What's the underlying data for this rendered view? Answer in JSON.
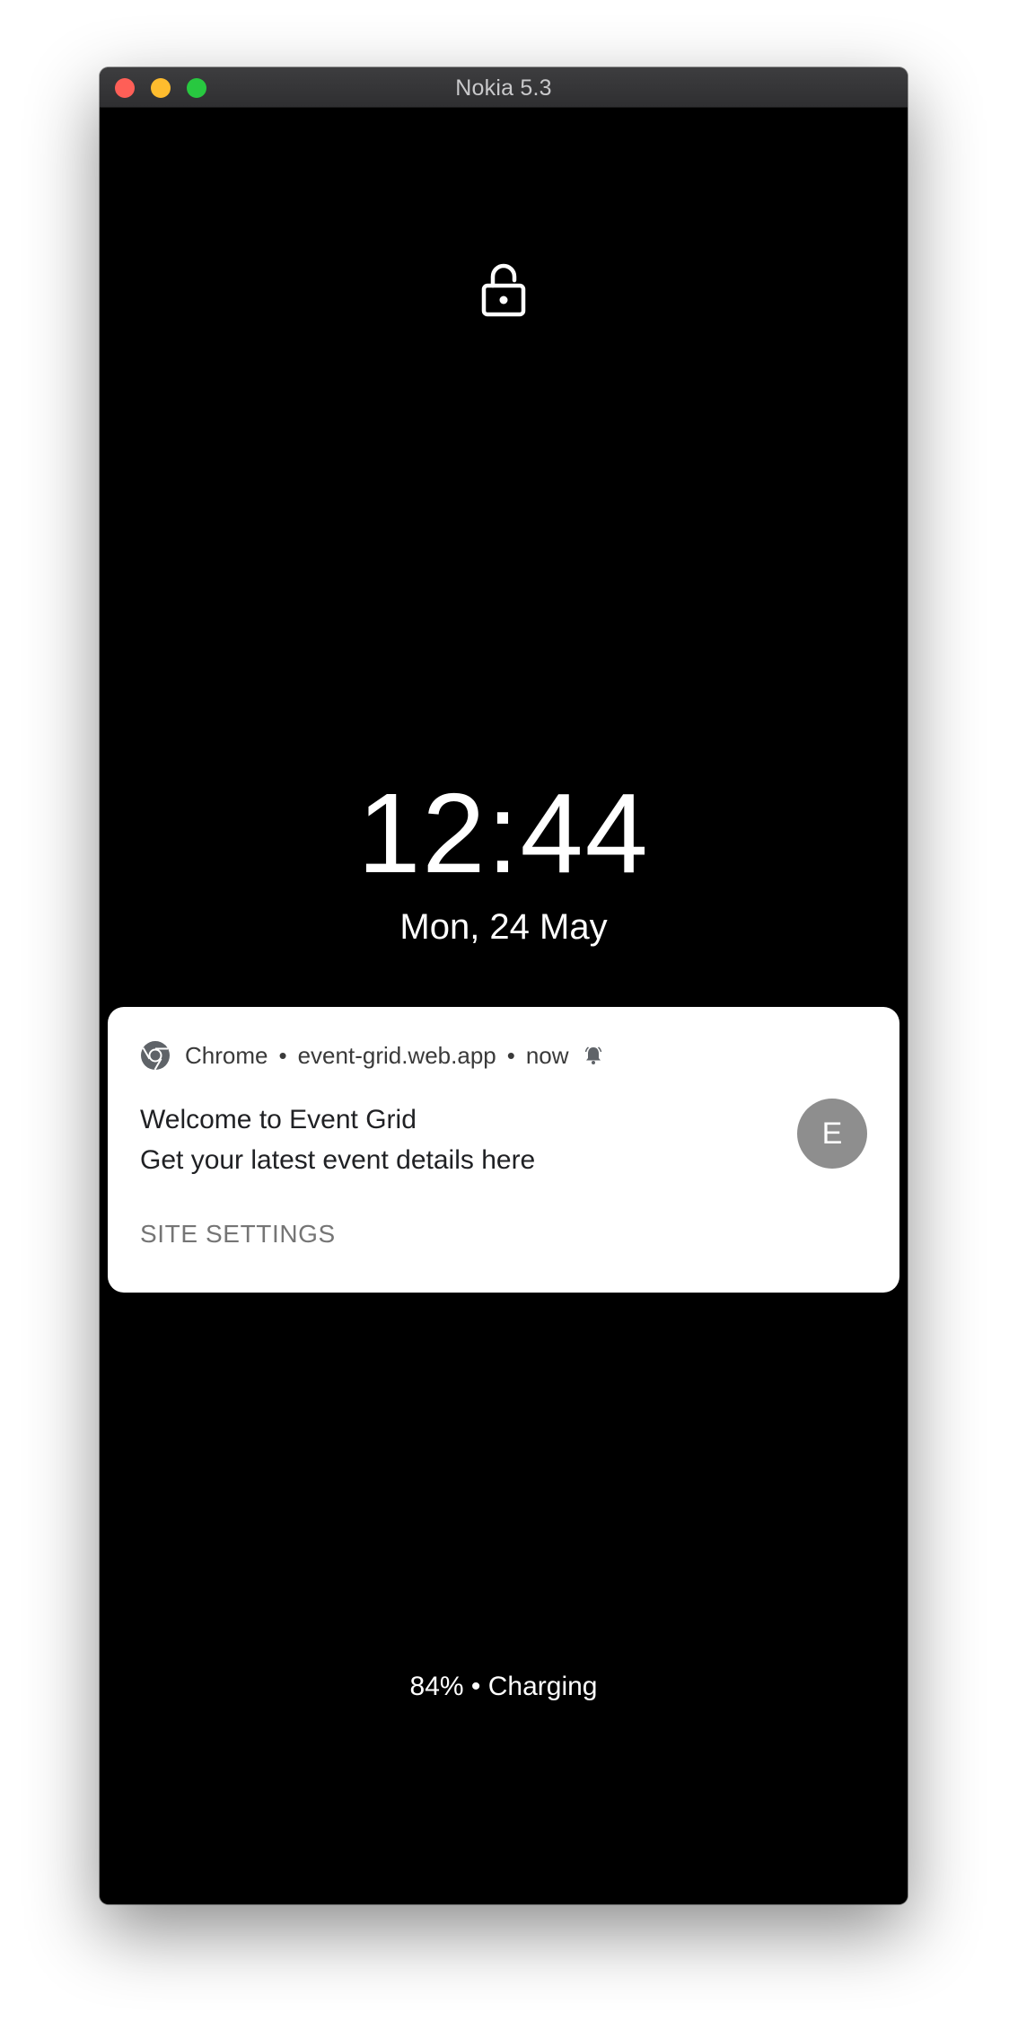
{
  "window": {
    "title": "Nokia 5.3"
  },
  "lockscreen": {
    "time": "12:44",
    "date": "Mon, 24 May",
    "battery_status": "84% • Charging",
    "icons": {
      "lock": "lock-icon"
    }
  },
  "notification": {
    "app_name": "Chrome",
    "separator": "•",
    "origin": "event-grid.web.app",
    "timestamp": "now",
    "title": "Welcome to Event Grid",
    "body": "Get your latest event details here",
    "avatar_letter": "E",
    "action_label": "SITE SETTINGS",
    "icons": {
      "app": "chrome-icon",
      "alert": "bell-icon"
    }
  },
  "colors": {
    "screen_bg": "#000000",
    "card_bg": "#ffffff",
    "avatar_bg": "#8e8e8e",
    "action_text": "#757575",
    "traffic_close": "#fe5f57",
    "traffic_minimize": "#febc2e",
    "traffic_maximize": "#28c840"
  }
}
